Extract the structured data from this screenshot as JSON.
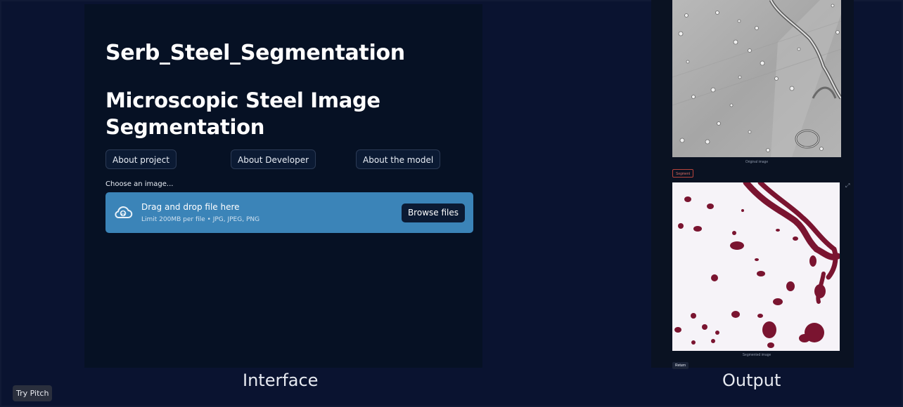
{
  "interface": {
    "app_title": "Serb_Steel_Segmentation",
    "subtitle": "Microscopic Steel Image Segmentation",
    "nav_buttons": [
      "About project",
      "About Developer",
      "About the model"
    ],
    "choose_label": "Choose an image...",
    "dropzone": {
      "title": "Drag and drop file here",
      "hint": "Limit 200MB per file • JPG, JPEG, PNG",
      "browse_label": "Browse files",
      "icon": "cloud-upload-icon"
    }
  },
  "output": {
    "original_caption": "Original image",
    "segment_label": "Segment",
    "segmented_caption": "Segmented image",
    "return_label": "Return"
  },
  "captions": {
    "interface": "Interface",
    "output": "Output"
  },
  "footer": {
    "try_pitch": "Try Pitch"
  },
  "colors": {
    "background": "#0a1330",
    "panel": "#061124",
    "dropzone": "#3b84b8",
    "segment_dark": "#7a1430"
  }
}
